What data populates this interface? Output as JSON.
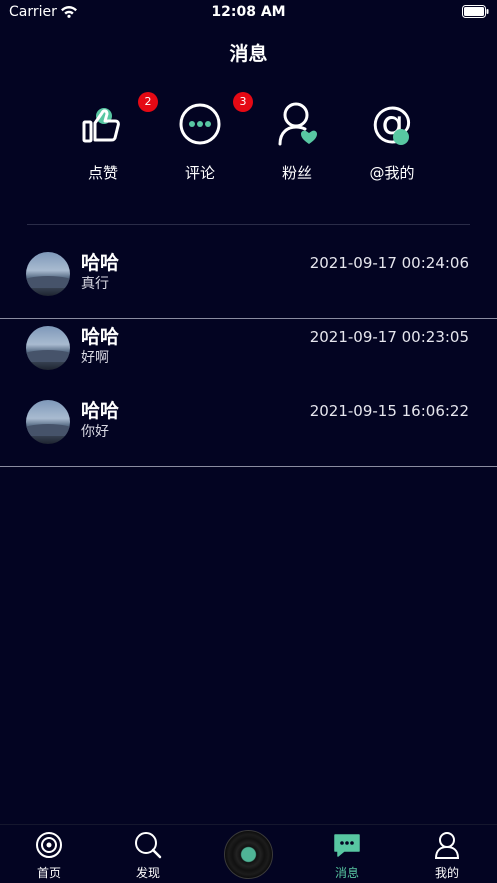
{
  "status_bar": {
    "carrier": "Carrier",
    "time": "12:08 AM"
  },
  "page": {
    "title": "消息"
  },
  "categories": [
    {
      "label": "点赞",
      "icon": "thumbs-up-icon",
      "badge": "2"
    },
    {
      "label": "评论",
      "icon": "comment-icon",
      "badge": "3"
    },
    {
      "label": "粉丝",
      "icon": "fans-icon",
      "badge": ""
    },
    {
      "label": "@我的",
      "icon": "at-mention-icon",
      "badge": ""
    }
  ],
  "messages": [
    {
      "name": "哈哈",
      "text": "真行",
      "time": "2021-09-17 00:24:06"
    },
    {
      "name": "哈哈",
      "text": "好啊",
      "time": "2021-09-17 00:23:05"
    },
    {
      "name": "哈哈",
      "text": "你好",
      "time": "2021-09-15 16:06:22"
    }
  ],
  "tab_bar": {
    "tabs": [
      {
        "label": "首页",
        "icon": "home-record-icon"
      },
      {
        "label": "发现",
        "icon": "search-icon"
      },
      {
        "label": "",
        "icon": "vinyl-record-icon"
      },
      {
        "label": "消息",
        "icon": "message-icon",
        "active": true
      },
      {
        "label": "我的",
        "icon": "profile-icon"
      }
    ]
  },
  "colors": {
    "background": "#030422",
    "accent": "#58c7a2",
    "badge": "#e50914"
  }
}
